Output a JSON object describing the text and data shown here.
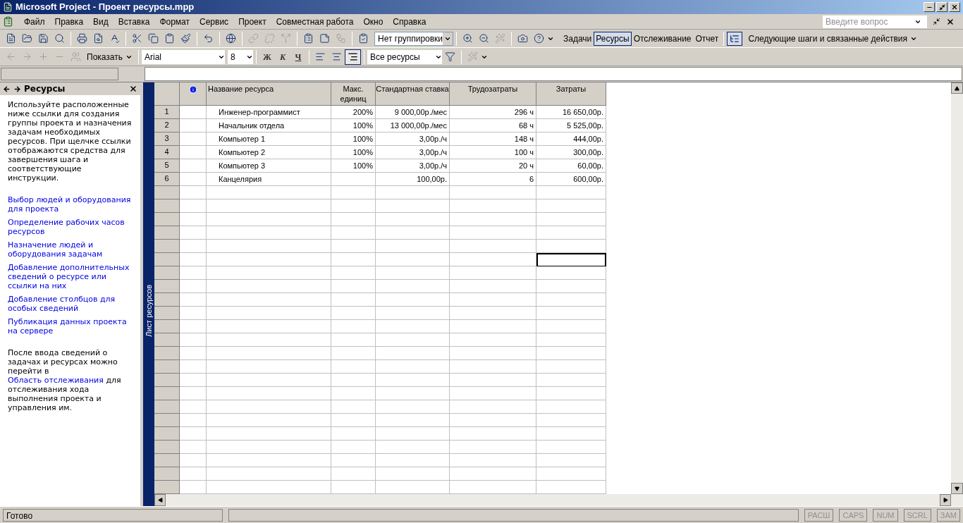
{
  "window": {
    "title": "Microsoft Project - Проект ресурсы.mpp"
  },
  "menu": [
    "Файл",
    "Правка",
    "Вид",
    "Вставка",
    "Формат",
    "Сервис",
    "Проект",
    "Совместная работа",
    "Окно",
    "Справка"
  ],
  "help_search": {
    "placeholder": "Введите вопрос"
  },
  "toolbar": {
    "grouping": "Нет группировки",
    "guide_tabs": [
      {
        "label": "Задачи",
        "selected": false
      },
      {
        "label": "Ресурсы",
        "selected": true
      },
      {
        "label": "Отслеживание",
        "selected": false
      },
      {
        "label": "Отчет",
        "selected": false
      }
    ],
    "next_steps": "Следующие шаги и связанные действия"
  },
  "format_toolbar": {
    "show": "Показать",
    "font": "Arial",
    "size": "8",
    "bold": "Ж",
    "italic": "К",
    "underline": "Ч",
    "filter": "Все ресурсы"
  },
  "task_pane": {
    "title": "Ресурсы",
    "intro": "Используйте расположенные ниже ссылки для создания группы проекта и назначения задачам необходимых ресурсов. При щелчке ссылки отображаются средства для завершения шага и соответствующие инструкции.",
    "links": [
      "Выбор людей и оборудования для проекта",
      "Определение рабочих часов ресурсов",
      "Назначение людей и оборудования задачам",
      "Добавление дополнительных сведений о ресурсе или ссылки на них",
      "Добавление столбцов для особых сведений",
      "Публикация данных проекта на сервере"
    ],
    "outro_before": "После ввода сведений о задачах и ресурсах можно перейти в",
    "outro_link": "Область отслеживания",
    "outro_after": "для отслеживания хода выполнения проекта и управления им."
  },
  "view_bar": {
    "label": "Лист ресурсов"
  },
  "table": {
    "columns": [
      "Название ресурса",
      "Макс. единиц",
      "Стандартная ставка",
      "Трудозатраты",
      "Затраты"
    ],
    "rows": [
      {
        "id": "1",
        "name": "Инженер-программист",
        "max": "200%",
        "rate": "9 000,00р./мес",
        "work": "296 ч",
        "cost": "16 650,00р."
      },
      {
        "id": "2",
        "name": "Начальник отдела",
        "max": "100%",
        "rate": "13 000,00р./мес",
        "work": "68 ч",
        "cost": "5 525,00р."
      },
      {
        "id": "3",
        "name": "Компьютер 1",
        "max": "100%",
        "rate": "3,00р./ч",
        "work": "148 ч",
        "cost": "444,00р."
      },
      {
        "id": "4",
        "name": "Компьютер 2",
        "max": "100%",
        "rate": "3,00р./ч",
        "work": "100 ч",
        "cost": "300,00р."
      },
      {
        "id": "5",
        "name": "Компьютер 3",
        "max": "100%",
        "rate": "3,00р./ч",
        "work": "20 ч",
        "cost": "60,00р."
      },
      {
        "id": "6",
        "name": "Канцелярия",
        "max": "",
        "rate": "100,00р.",
        "work": "6",
        "cost": "600,00р."
      }
    ],
    "blank_rows": [
      {
        "selected": false
      },
      {
        "selected": false
      },
      {
        "selected": false
      },
      {
        "selected": false
      },
      {
        "selected": false
      },
      {
        "selected": true
      },
      {
        "selected": false
      },
      {
        "selected": false
      },
      {
        "selected": false
      },
      {
        "selected": false
      },
      {
        "selected": false
      },
      {
        "selected": false
      },
      {
        "selected": false
      },
      {
        "selected": false
      },
      {
        "selected": false
      },
      {
        "selected": false
      },
      {
        "selected": false
      },
      {
        "selected": false
      },
      {
        "selected": false
      },
      {
        "selected": false
      },
      {
        "selected": false
      },
      {
        "selected": false
      },
      {
        "selected": false
      }
    ]
  },
  "status_bar": {
    "text": "Готово",
    "indicators": [
      {
        "label": "РАСШ",
        "on": false
      },
      {
        "label": "CAPS",
        "on": false
      },
      {
        "label": "NUM",
        "on": false
      },
      {
        "label": "SCRL",
        "on": false
      },
      {
        "label": "ЗАМ",
        "on": false
      }
    ]
  }
}
